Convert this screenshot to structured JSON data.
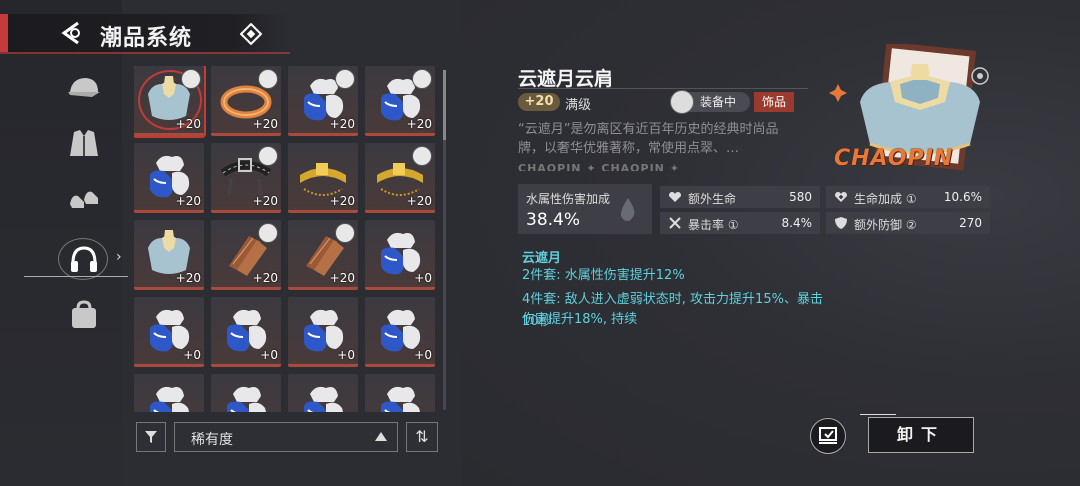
{
  "header": {
    "title": "潮品系统"
  },
  "sidebar": {
    "items": [
      {
        "name": "hat-icon"
      },
      {
        "name": "jacket-icon"
      },
      {
        "name": "shoes-icon"
      },
      {
        "name": "headphones-icon"
      },
      {
        "name": "bag-icon"
      }
    ],
    "selected_index": 3
  },
  "grid": {
    "items": [
      {
        "type": "cape",
        "qty": "+20",
        "avatar": true,
        "selected": true
      },
      {
        "type": "ring",
        "qty": "+20",
        "avatar": true
      },
      {
        "type": "bag",
        "qty": "+20",
        "avatar": true
      },
      {
        "type": "bag",
        "qty": "+20",
        "avatar": true
      },
      {
        "type": "bag",
        "qty": "+20",
        "avatar": false
      },
      {
        "type": "belt",
        "qty": "+20",
        "avatar": true
      },
      {
        "type": "goldbelt",
        "qty": "+20",
        "avatar": false
      },
      {
        "type": "goldbelt",
        "qty": "+20",
        "avatar": true
      },
      {
        "type": "cape",
        "qty": "+20",
        "avatar": false
      },
      {
        "type": "strap",
        "qty": "+20",
        "avatar": true
      },
      {
        "type": "strap",
        "qty": "+20",
        "avatar": true
      },
      {
        "type": "bag",
        "qty": "+0",
        "avatar": false
      },
      {
        "type": "bag",
        "qty": "+0",
        "avatar": false
      },
      {
        "type": "bag",
        "qty": "+0",
        "avatar": false
      },
      {
        "type": "bag",
        "qty": "+0",
        "avatar": false
      },
      {
        "type": "bag",
        "qty": "+0",
        "avatar": false
      },
      {
        "type": "bag",
        "qty": "",
        "avatar": false
      },
      {
        "type": "bag",
        "qty": "",
        "avatar": false
      },
      {
        "type": "bag",
        "qty": "",
        "avatar": false
      },
      {
        "type": "bag",
        "qty": "",
        "avatar": false
      }
    ]
  },
  "controls": {
    "sort_label": "稀有度"
  },
  "detail": {
    "name": "云遮月云肩",
    "level": "+20",
    "level_text": "满级",
    "equipped_label": "装备中",
    "type_label": "饰品",
    "description": "“云遮月”是勿离区有近百年历史的经典时尚品牌，以奢华优雅著称，常使用点翠、…",
    "brand_strip": "CHAOPIN ✦ CHAOPIN ✦ CHAOPIN",
    "main_attr": {
      "label": "水属性伤害加成",
      "value": "38.4%"
    },
    "attrs": [
      {
        "icon": "heart-icon",
        "label": "额外生命",
        "value": "580"
      },
      {
        "icon": "heart-plus-icon",
        "label": "生命加成 ①",
        "value": "10.6%"
      },
      {
        "icon": "crit-icon",
        "label": "暴击率 ①",
        "value": "8.4%"
      },
      {
        "icon": "shield-icon",
        "label": "额外防御 ②",
        "value": "270"
      }
    ],
    "set": {
      "title": "云遮月",
      "two_piece": "2件套: 水属性伤害提升12%",
      "four_piece": "4件套: 敌人进入虚弱状态时, 攻击力提升15%、暴击伤害提升18%, 持续",
      "four_piece_cont": "10秒"
    },
    "art_text": "CHAOPIN",
    "unequip_label": "卸下"
  }
}
